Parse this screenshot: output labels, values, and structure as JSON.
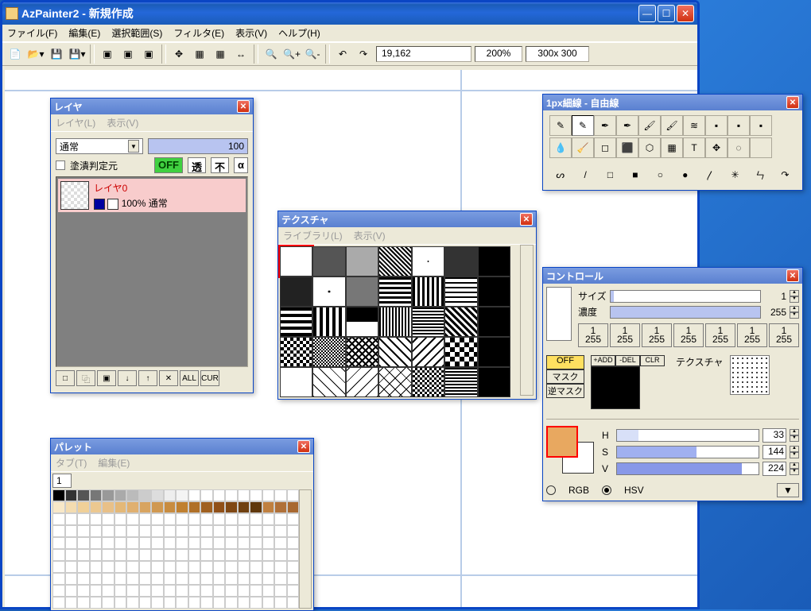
{
  "app": {
    "title": "AzPainter2 - 新規作成",
    "menus": [
      "ファイル(F)",
      "編集(E)",
      "選択範囲(S)",
      "フィルタ(E)",
      "表示(V)",
      "ヘルプ(H)"
    ],
    "status": {
      "coords": "19,162",
      "zoom": "200%",
      "size": "300x 300"
    }
  },
  "layer": {
    "title": "レイヤ",
    "menus": [
      "レイヤ(L)",
      "表示(V)"
    ],
    "blend": "通常",
    "opacity": "100",
    "judge_label": "塗潰判定元",
    "badges": [
      "OFF",
      "透",
      "不",
      "α"
    ],
    "item": {
      "name": "レイヤ0",
      "pct": "100% 通常"
    },
    "buttons": [
      "□",
      "⿻",
      "▣",
      "↓",
      "↑",
      "✕",
      "ALL",
      "CUR"
    ]
  },
  "texture": {
    "title": "テクスチャ",
    "menus": [
      "ライブラリ(L)",
      "表示(V)"
    ]
  },
  "tools": {
    "title": "1px細線 - 自由線"
  },
  "control": {
    "title": "コントロール",
    "size_label": "サイズ",
    "size_val": "1",
    "dens_label": "濃度",
    "dens_val": "255",
    "nums": [
      {
        "t": "1",
        "b": "255"
      },
      {
        "t": "1",
        "b": "255"
      },
      {
        "t": "1",
        "b": "255"
      },
      {
        "t": "1",
        "b": "255"
      },
      {
        "t": "1",
        "b": "255"
      },
      {
        "t": "1",
        "b": "255"
      },
      {
        "t": "1",
        "b": "255"
      }
    ],
    "mask": {
      "off": "OFF",
      "mask": "マスク",
      "rev": "逆マスク",
      "ops": [
        "+ADD",
        "-DEL",
        "CLR"
      ]
    },
    "tex_label": "テクスチャ",
    "hsv": [
      {
        "l": "H",
        "v": "33",
        "f": 15
      },
      {
        "l": "S",
        "v": "144",
        "f": 56
      },
      {
        "l": "V",
        "v": "224",
        "f": 88
      }
    ],
    "modes": {
      "rgb": "RGB",
      "hsv": "HSV"
    }
  },
  "palette": {
    "title": "パレット",
    "menus": [
      "タブ(T)",
      "編集(E)"
    ],
    "tab": "1"
  }
}
